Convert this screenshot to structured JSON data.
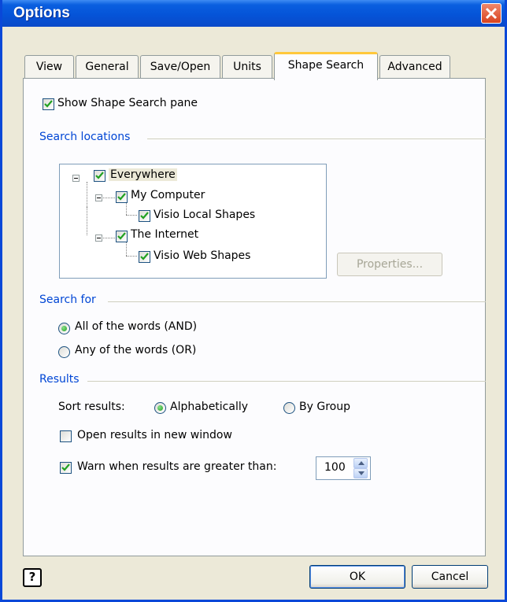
{
  "window": {
    "title": "Options"
  },
  "tabs": [
    {
      "label": "View"
    },
    {
      "label": "General"
    },
    {
      "label": "Save/Open"
    },
    {
      "label": "Units"
    },
    {
      "label": "Shape Search",
      "active": true
    },
    {
      "label": "Advanced"
    }
  ],
  "show_pane": {
    "label": "Show Shape Search pane",
    "checked": true
  },
  "search_locations": {
    "group_label": "Search locations",
    "tree": [
      {
        "label": "Everywhere",
        "checked": true,
        "selected": true
      },
      {
        "label": "My Computer",
        "checked": true
      },
      {
        "label": "Visio Local Shapes",
        "checked": true
      },
      {
        "label": "The Internet",
        "checked": true
      },
      {
        "label": "Visio Web Shapes",
        "checked": true
      }
    ],
    "properties_button": "Properties...",
    "properties_enabled": false
  },
  "search_for": {
    "group_label": "Search for",
    "options": [
      {
        "label": "All of the words (AND)",
        "selected": true
      },
      {
        "label": "Any of the words (OR)",
        "selected": false
      }
    ]
  },
  "results": {
    "group_label": "Results",
    "sort_label": "Sort results:",
    "sort_options": [
      {
        "label": "Alphabetically",
        "selected": true
      },
      {
        "label": "By Group",
        "selected": false
      }
    ],
    "open_new_window": {
      "label": "Open results in new window",
      "checked": false
    },
    "warn": {
      "label": "Warn when results are greater than:",
      "checked": true,
      "value": "100"
    }
  },
  "footer": {
    "help_glyph": "?",
    "ok_label": "OK",
    "cancel_label": "Cancel"
  },
  "colors": {
    "titlebar": "#0554d8",
    "group_label": "#0046d5",
    "dialog_bg": "#ece9d8",
    "check_mark": "#21a121",
    "active_tab_accent": "#ffc83c"
  }
}
